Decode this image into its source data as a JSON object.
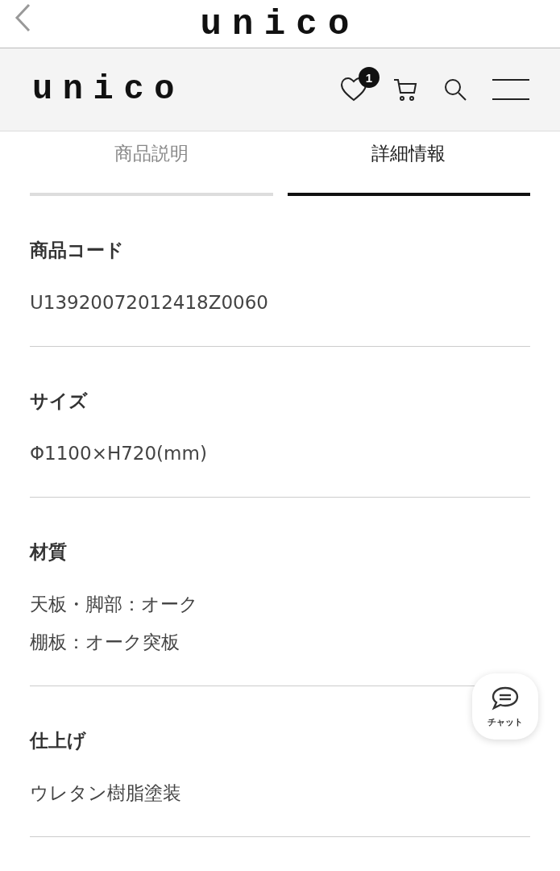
{
  "top_bar": {
    "title": "unico"
  },
  "header": {
    "logo": "unico",
    "favorites_count": "1"
  },
  "tabs": [
    {
      "label": "商品説明",
      "selected": false
    },
    {
      "label": "詳細情報",
      "selected": true
    }
  ],
  "sections": [
    {
      "label": "商品コード",
      "lines": [
        "U13920072012418Z0060"
      ]
    },
    {
      "label": "サイズ",
      "lines": [
        "Φ1100×H720(mm)"
      ]
    },
    {
      "label": "材質",
      "lines": [
        "天板・脚部：オーク",
        "棚板：オーク突板"
      ]
    },
    {
      "label": "仕上げ",
      "lines": [
        "ウレタン樹脂塗装"
      ]
    }
  ],
  "chat": {
    "label": "チャット"
  }
}
